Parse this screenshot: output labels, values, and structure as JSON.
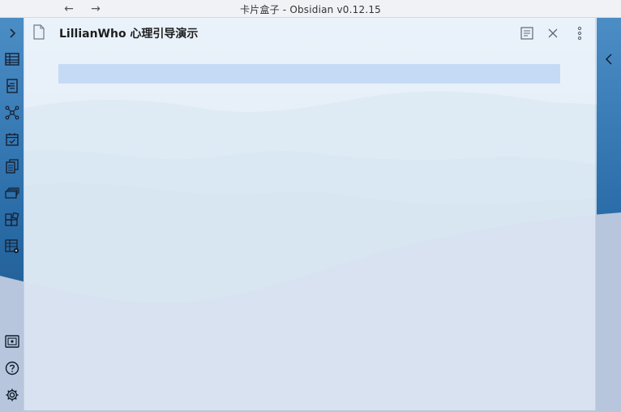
{
  "window": {
    "title": "卡片盒子 - Obsidian v0.12.15",
    "back_icon": "arrow-left-icon",
    "forward_icon": "arrow-right-icon"
  },
  "ribbon": {
    "items": [
      {
        "icon": "chevron-right-icon"
      },
      {
        "icon": "table-icon"
      },
      {
        "icon": "document-list-icon"
      },
      {
        "icon": "graph-view-icon"
      },
      {
        "icon": "calendar-check-icon"
      },
      {
        "icon": "copy-files-icon"
      },
      {
        "icon": "cards-icon"
      },
      {
        "icon": "plugin-grid-icon"
      },
      {
        "icon": "table-settings-icon"
      },
      {
        "icon": "vault-icon"
      },
      {
        "icon": "help-icon"
      },
      {
        "icon": "settings-gear-icon"
      }
    ]
  },
  "pane": {
    "title": "LillianWho 心理引导演示",
    "file_icon": "document-icon",
    "actions": [
      "reading-view-icon",
      "close-icon",
      "more-options-icon"
    ],
    "editor_content": ""
  },
  "colors": {
    "pane_bg": "#ecf4fb",
    "highlight_line": "#bed6f4",
    "sky": "#d8e6f0",
    "mountain_front": "#b7c6dc",
    "accent_dark_blue": "#1b5f9e"
  }
}
